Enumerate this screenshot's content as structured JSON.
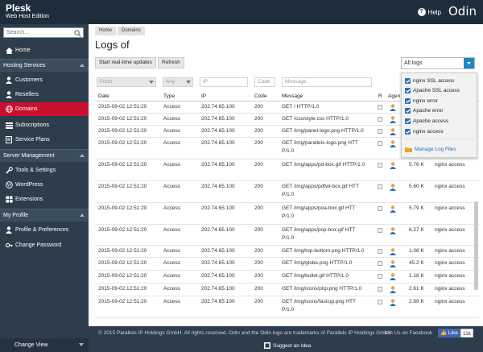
{
  "header": {
    "brand_title": "Plesk",
    "brand_subtitle": "Web Host Edition",
    "help_label": "Help",
    "odin_logo": "Odin"
  },
  "sidebar": {
    "search_placeholder": "Search...",
    "home": "Home",
    "section_hosting": "Hosting Services",
    "customers": "Customers",
    "resellers": "Resellers",
    "domains": "Domains",
    "subscriptions": "Subscriptions",
    "service_plans": "Service Plans",
    "section_server": "Server Management",
    "tools": "Tools & Settings",
    "wordpress": "WordPress",
    "extensions": "Extensions",
    "section_profile": "My Profile",
    "profile_prefs": "Profile & Preferences",
    "change_password": "Change Password",
    "change_view": "Change View"
  },
  "breadcrumb": [
    "Home",
    "Domains"
  ],
  "page_title": "Logs of",
  "toolbar": {
    "realtime": "Start real-time updates",
    "refresh": "Refresh",
    "log_select": "All logs"
  },
  "filters": {
    "from": "From",
    "any": "Any",
    "ip": "IP",
    "code": "Code",
    "message": "Message"
  },
  "columns": {
    "date": "Date",
    "type": "Type",
    "ip": "IP",
    "code": "Code",
    "message": "Message",
    "r": "R",
    "agent": "Agen"
  },
  "rows": [
    {
      "date": "2015-09-02 12:51:20",
      "type": "Access",
      "ip": "202.74.65.100",
      "code": "200",
      "msg1": "GET / HTTP/1.0",
      "msg2": "",
      "size": "",
      "source": ""
    },
    {
      "date": "2015-09-02 12:51:20",
      "type": "Access",
      "ip": "202.74.65.100",
      "code": "200",
      "msg1": "GET /css/style.css HTTP/1.0",
      "msg2": "",
      "size": "",
      "source": ""
    },
    {
      "date": "2015-09-02 12:51:20",
      "type": "Access",
      "ip": "202.74.65.100",
      "code": "200",
      "msg1": "GET /img/panel-logo.png HTTP/1.0",
      "msg2": "",
      "size": "",
      "source": ""
    },
    {
      "date": "2015-09-02 12:51:20",
      "type": "Access",
      "ip": "202.74.65.100",
      "code": "200",
      "msg1": "GET /img/parallels-logo.png HTT",
      "msg2": "P/1.0",
      "size": "",
      "source": ""
    },
    {
      "date": "2015-09-02 12:51:20",
      "type": "Access",
      "ip": "202.74.65.100",
      "code": "200",
      "msg1": "GET /img/apps/pd-box.gif HTTP/1.0",
      "msg2": "",
      "size": "5.76 K",
      "source": "nginx access"
    },
    {
      "date": "2015-09-02 12:51:20",
      "type": "Access",
      "ip": "202.74.65.100",
      "code": "200",
      "msg1": "GET /img/apps/pdfwl-box.gif HTT",
      "msg2": "P/1.0",
      "size": "5.60 K",
      "source": "nginx access"
    },
    {
      "date": "2015-09-02 12:51:20",
      "type": "Access",
      "ip": "202.74.65.100",
      "code": "200",
      "msg1": "GET /img/apps/poa-box.gif HTT",
      "msg2": "P/1.0",
      "size": "5.79 K",
      "source": "nginx access"
    },
    {
      "date": "2015-09-02 12:51:20",
      "type": "Access",
      "ip": "202.74.65.100",
      "code": "200",
      "msg1": "GET /img/apps/pcp-box.gif HTT",
      "msg2": "P/1.0",
      "size": "6.27 K",
      "source": "nginx access"
    },
    {
      "date": "2015-09-02 12:51:20",
      "type": "Access",
      "ip": "202.74.65.100",
      "code": "200",
      "msg1": "GET /img/top-bottom.png HTTP/1.0",
      "msg2": "",
      "size": "1.08 K",
      "source": "nginx access"
    },
    {
      "date": "2015-09-02 12:51:20",
      "type": "Access",
      "ip": "202.74.65.100",
      "code": "200",
      "msg1": "GET /img/globe.png HTTP/1.0",
      "msg2": "",
      "size": "45.2 K",
      "source": "nginx access"
    },
    {
      "date": "2015-09-02 12:51:20",
      "type": "Access",
      "ip": "202.74.65.100",
      "code": "200",
      "msg1": "GET /img/bullet.gif HTTP/1.0",
      "msg2": "",
      "size": "1.18 K",
      "source": "nginx access"
    },
    {
      "date": "2015-09-02 12:51:20",
      "type": "Access",
      "ip": "202.74.65.100",
      "code": "200",
      "msg1": "GET /img/icons/php.png HTTP/1.0",
      "msg2": "",
      "size": "2.61 K",
      "source": "nginx access"
    },
    {
      "date": "2015-09-02 12:51:20",
      "type": "Access",
      "ip": "202.74.65.100",
      "code": "200",
      "msg1": "GET /img/icons/fastcgi.png HTT",
      "msg2": "P/1.0",
      "size": "2.89 K",
      "source": "nginx access"
    }
  ],
  "log_filter_popup": {
    "options": [
      "nginx SSL access",
      "Apache SSL access",
      "nginx error",
      "Apache error",
      "Apache access",
      "nginx access"
    ],
    "manage": "Manage Log Files"
  },
  "footer": {
    "copyright": "© 2015 Parallels IP Holdings GmbH. All rights reserved. Odin and the Odin logo are trademarks of Parallels IP Holdings GmbH.",
    "facebook": "Join Us on Facebook",
    "like": "Like",
    "like_count": "11k",
    "suggest": "Suggest an Idea"
  },
  "colors": {
    "topbar": "#1e2d3b",
    "sidebar": "#2e3d4b",
    "active": "#c8102e",
    "accent": "#2186c4"
  }
}
